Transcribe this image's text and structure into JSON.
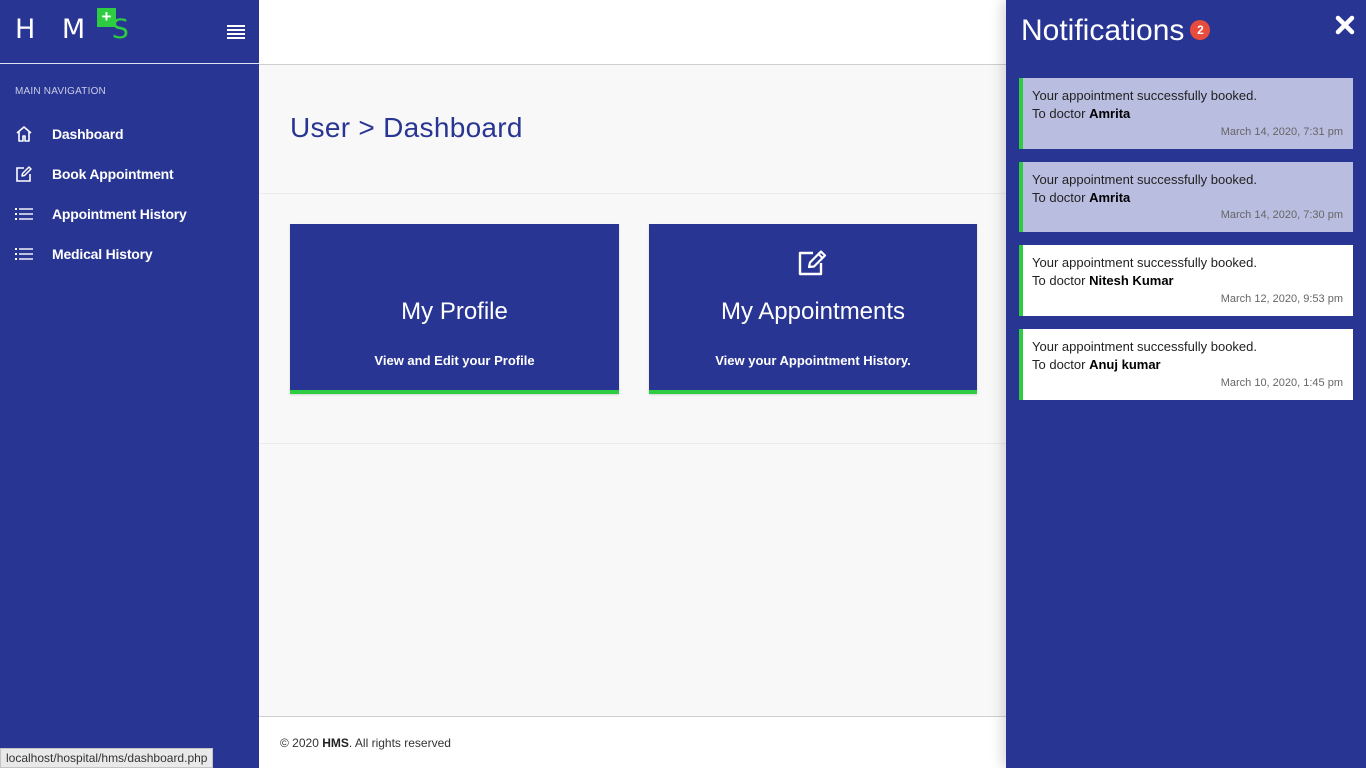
{
  "brand": {
    "letters": "H M",
    "s_letter": "S",
    "plus": "+"
  },
  "sidebar": {
    "caption": "MAIN NAVIGATION",
    "items": [
      {
        "label": "Dashboard",
        "icon": "home-icon"
      },
      {
        "label": "Book Appointment",
        "icon": "edit-icon"
      },
      {
        "label": "Appointment History",
        "icon": "list-icon"
      },
      {
        "label": "Medical History",
        "icon": "list-icon"
      }
    ]
  },
  "page": {
    "title": "User > Dashboard"
  },
  "cards": [
    {
      "title": "My Profile",
      "subtitle": "View and Edit your Profile"
    },
    {
      "title": "My Appointments",
      "subtitle": "View your Appointment History.",
      "icon": "edit-icon"
    }
  ],
  "footer": {
    "prefix": "© 2020 ",
    "brand": "HMS",
    "suffix": ". All rights reserved"
  },
  "statusbar": {
    "url": "localhost/hospital/hms/dashboard.php"
  },
  "notifications": {
    "title": "Notifications",
    "badge": "2",
    "items": [
      {
        "line1": "Your appointment successfully booked.",
        "prefix": "To doctor ",
        "doctor": "Amrita",
        "time": "March 14, 2020, 7:31 pm",
        "unread": true
      },
      {
        "line1": "Your appointment successfully booked.",
        "prefix": "To doctor ",
        "doctor": "Amrita",
        "time": "March 14, 2020, 7:30 pm",
        "unread": true
      },
      {
        "line1": "Your appointment successfully booked.",
        "prefix": "To doctor ",
        "doctor": "Nitesh Kumar",
        "time": "March 12, 2020, 9:53 pm",
        "unread": false
      },
      {
        "line1": "Your appointment successfully booked.",
        "prefix": "To doctor ",
        "doctor": "Anuj kumar",
        "time": "March 10, 2020, 1:45 pm",
        "unread": false
      }
    ]
  },
  "colors": {
    "primary": "#283593",
    "accent": "#2ecc40",
    "badge": "#e74c3c",
    "unread_bg": "#b9bde0"
  }
}
